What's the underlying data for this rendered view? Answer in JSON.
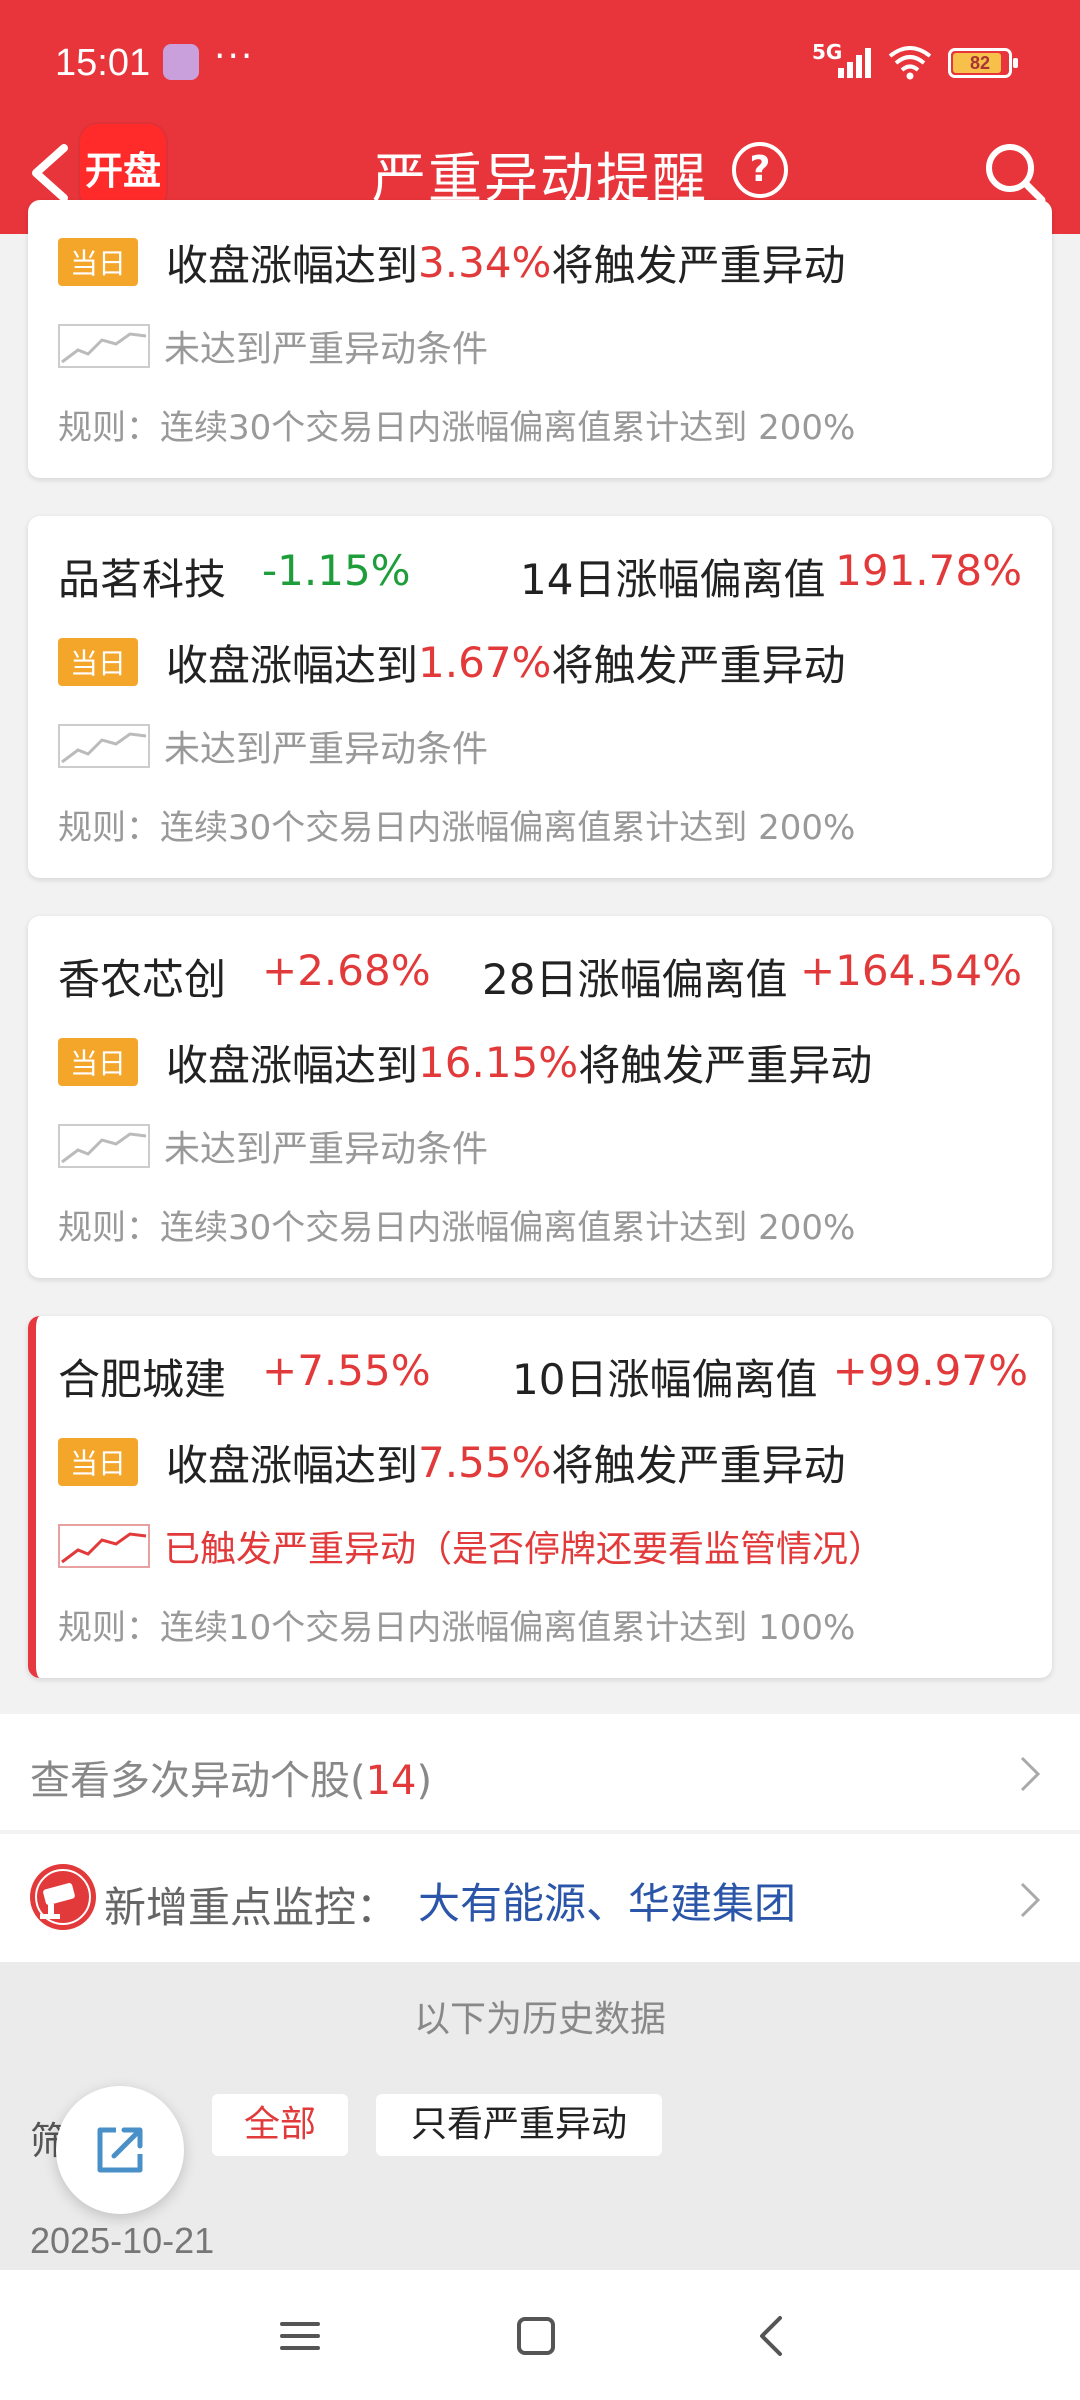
{
  "status_bar": {
    "time": "15:01",
    "dots": "···",
    "network": "5G",
    "battery": "82"
  },
  "nav": {
    "back_icon": "chevron-left-icon",
    "logo_text": "开盘",
    "title": "严重异动提醒",
    "help": "?",
    "search_icon": "search-icon"
  },
  "cards": [
    {
      "trigger": {
        "badge": "当日",
        "prefix": "收盘涨幅达到",
        "pct": "3.34%",
        "suffix": "将触发严重异动"
      },
      "state": "未达到严重异动条件",
      "rule": "规则：连续30个交易日内涨幅偏离值累计达到 200%"
    },
    {
      "name": "品茗科技",
      "change": "-1.15%",
      "metric": "14日涨幅偏离值",
      "metric_value": "191.78%",
      "trigger": {
        "badge": "当日",
        "prefix": "收盘涨幅达到",
        "pct": "1.67%",
        "suffix": "将触发严重异动"
      },
      "state": "未达到严重异动条件",
      "rule": "规则：连续30个交易日内涨幅偏离值累计达到 200%"
    },
    {
      "name": "香农芯创",
      "change": "+2.68%",
      "metric": "28日涨幅偏离值",
      "metric_value": "+164.54%",
      "trigger": {
        "badge": "当日",
        "prefix": "收盘涨幅达到",
        "pct": "16.15%",
        "suffix": "将触发严重异动"
      },
      "state": "未达到严重异动条件",
      "rule": "规则：连续30个交易日内涨幅偏离值累计达到 200%"
    },
    {
      "name": "合肥城建",
      "change": "+7.55%",
      "metric": "10日涨幅偏离值",
      "metric_value": "+99.97%",
      "trigger": {
        "badge": "当日",
        "prefix": "收盘涨幅达到",
        "pct": "7.55%",
        "suffix": "将触发严重异动"
      },
      "state": "已触发严重异动（是否停牌还要看监管情况）",
      "rule": "规则：连续10个交易日内涨幅偏离值累计达到 100%"
    }
  ],
  "multi_anomaly": {
    "label": "查看多次异动个股(",
    "count": "14",
    "close": ")"
  },
  "monitor": {
    "label": "新增重点监控：",
    "stocks": "大有能源、华建集团"
  },
  "history": {
    "header": "以下为历史数据",
    "filter_label": "筛选",
    "filters": [
      "全部",
      "只看严重异动"
    ],
    "date": "2025-10-21"
  },
  "colors": {
    "header": "#e8353b",
    "red": "#e23a3a",
    "green": "#1e9e3a",
    "badge": "#f4a62a",
    "link": "#2a55a8"
  }
}
